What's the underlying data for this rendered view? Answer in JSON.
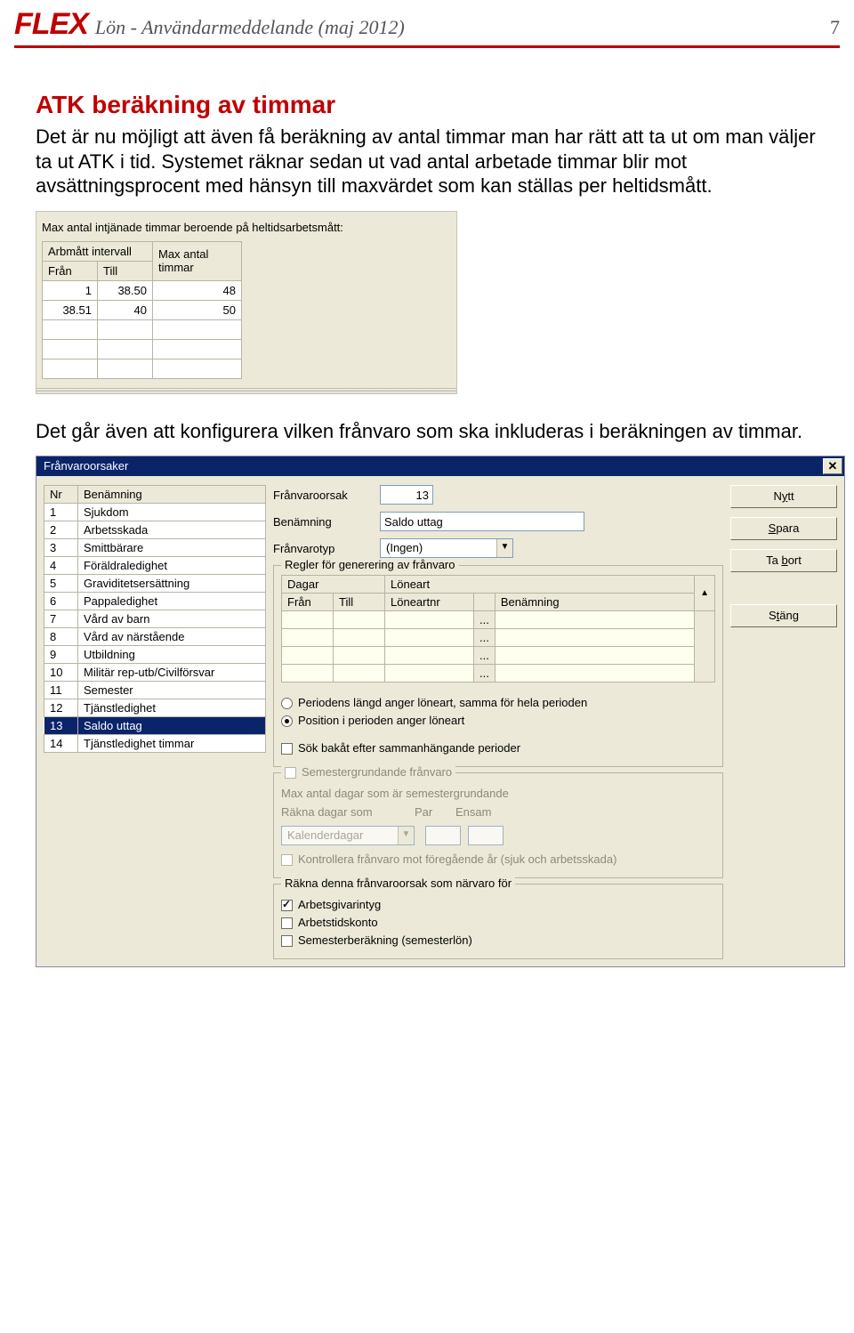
{
  "header": {
    "logo": "FLEX",
    "subtitle": "Lön - Användarmeddelande (maj 2012)",
    "page_number": "7"
  },
  "section_title": "ATK beräkning av timmar",
  "paragraph1": "Det är nu möjligt att även få beräkning av antal timmar man har rätt att ta ut om man väljer ta ut ATK i tid. Systemet räknar sedan ut vad antal arbetade timmar blir mot avsättningsprocent med hänsyn till maxvärdet som kan ställas per heltidsmått.",
  "ss1": {
    "caption": "Max antal intjänade timmar beroende på heltidsarbetsmått:",
    "headers": {
      "group": "Arbmått intervall",
      "fran": "Från",
      "till": "Till",
      "max": "Max antal timmar"
    },
    "rows": [
      {
        "fran": "1",
        "till": "38.50",
        "max": "48"
      },
      {
        "fran": "38.51",
        "till": "40",
        "max": "50"
      },
      {
        "fran": "",
        "till": "",
        "max": ""
      },
      {
        "fran": "",
        "till": "",
        "max": ""
      },
      {
        "fran": "",
        "till": "",
        "max": ""
      }
    ]
  },
  "paragraph2": "Det går även att konfigurera vilken frånvaro som ska inkluderas i beräkningen av timmar.",
  "ss2": {
    "title": "Frånvaroorsaker",
    "list_headers": {
      "nr": "Nr",
      "ben": "Benämning"
    },
    "items": [
      {
        "nr": "1",
        "ben": "Sjukdom"
      },
      {
        "nr": "2",
        "ben": "Arbetsskada"
      },
      {
        "nr": "3",
        "ben": "Smittbärare"
      },
      {
        "nr": "4",
        "ben": "Föräldraledighet"
      },
      {
        "nr": "5",
        "ben": "Graviditetsersättning"
      },
      {
        "nr": "6",
        "ben": "Pappaledighet"
      },
      {
        "nr": "7",
        "ben": "Vård av barn"
      },
      {
        "nr": "8",
        "ben": "Vård av närstående"
      },
      {
        "nr": "9",
        "ben": "Utbildning"
      },
      {
        "nr": "10",
        "ben": "Militär rep-utb/Civilförsvar"
      },
      {
        "nr": "11",
        "ben": "Semester"
      },
      {
        "nr": "12",
        "ben": "Tjänstledighet"
      },
      {
        "nr": "13",
        "ben": "Saldo uttag"
      },
      {
        "nr": "14",
        "ben": "Tjänstledighet timmar"
      }
    ],
    "selected_nr": "13",
    "form": {
      "franvaroorsak_label": "Frånvaroorsak",
      "franvaroorsak_value": "13",
      "benamning_label": "Benämning",
      "benamning_value": "Saldo uttag",
      "franvarotyp_label": "Frånvarotyp",
      "franvarotyp_value": "(Ingen)"
    },
    "rules": {
      "group_title": "Regler för generering av frånvaro",
      "dagar": "Dagar",
      "loneart": "Löneart",
      "fran": "Från",
      "till": "Till",
      "loneartnr": "Löneartnr",
      "benamning": "Benämning",
      "ellipsis": "...",
      "radio1": "Periodens längd anger löneart, samma för hela perioden",
      "radio2": "Position i perioden anger löneart",
      "check_search": "Sök bakåt efter sammanhängande perioder"
    },
    "sem_group": {
      "title": "Semestergrundande frånvaro",
      "max_label": "Max antal dagar som är semestergrundande",
      "rakna_label": "Räkna dagar som",
      "par": "Par",
      "ensam": "Ensam",
      "combo_value": "Kalenderdagar",
      "kontrollera": "Kontrollera frånvaro mot föregående år (sjuk och arbetsskada)"
    },
    "narvaro_group": {
      "title": "Räkna denna frånvaroorsak som närvaro för",
      "c1": "Arbetsgivarintyg",
      "c2": "Arbetstidskonto",
      "c3": "Semesterberäkning (semesterlön)"
    },
    "buttons": {
      "nytt": "Nytt",
      "spara": "Spara",
      "tabort": "Ta bort",
      "stang": "Stäng"
    }
  }
}
